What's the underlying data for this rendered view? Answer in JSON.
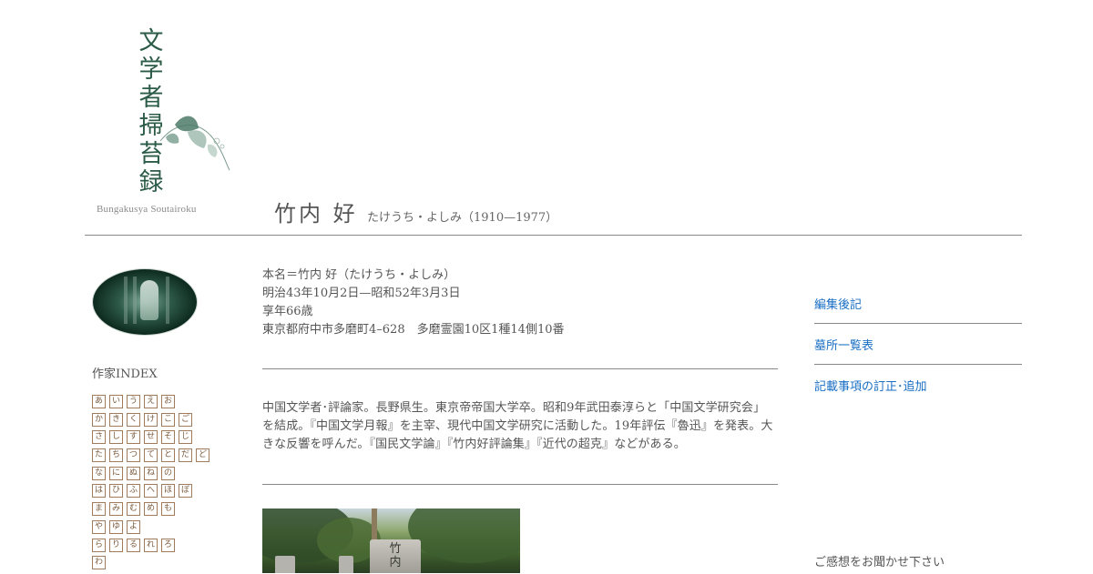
{
  "logo": {
    "title_chars": [
      "文",
      "学",
      "者",
      "掃",
      "苔",
      "録"
    ],
    "roman": "Bungakusya Soutairoku"
  },
  "header": {
    "name": "竹内 好",
    "reading": "たけうち・よしみ（1910—1977）"
  },
  "sidebar": {
    "index_heading": "作家INDEX",
    "kana_rows": [
      [
        "あ",
        "い",
        "う",
        "え",
        "お"
      ],
      [
        "か",
        "き",
        "く",
        "け",
        "こ",
        "ご"
      ],
      [
        "さ",
        "し",
        "す",
        "せ",
        "そ",
        "じ"
      ],
      [
        "た",
        "ち",
        "つ",
        "て",
        "と",
        "だ",
        "ど"
      ],
      [
        "な",
        "に",
        "ぬ",
        "ね",
        "の"
      ],
      [
        "は",
        "ひ",
        "ふ",
        "へ",
        "ほ",
        "ぼ"
      ],
      [
        "ま",
        "み",
        "む",
        "め",
        "も"
      ],
      [
        "や",
        "ゆ",
        "よ"
      ],
      [
        "ら",
        "り",
        "る",
        "れ",
        "ろ"
      ],
      [
        "わ"
      ]
    ]
  },
  "main": {
    "info_lines": [
      "本名＝竹内 好（たけうち・よしみ）",
      "明治43年10月2日—昭和52年3月3日",
      "享年66歳",
      "東京都府中市多磨町4–628　多磨霊園10区1種14側10番"
    ],
    "bio": "中国文学者･評論家。長野県生。東京帝帝国大学卒。昭和9年武田泰淳らと「中国文学研究会」を結成。『中国文学月報』を主宰、現代中国文学研究に活動した。19年評伝『魯迅』を発表。大きな反響を呼んだ。『国民文学論』『竹内好評論集』『近代の超克』などがある。",
    "photo_text": "竹内"
  },
  "right_nav": {
    "links": [
      "編集後記",
      "墓所一覧表",
      "記載事項の訂正･追加"
    ],
    "feedback": "ご感想をお聞かせ下さい"
  },
  "colors": {
    "link": "#1a6fc4",
    "kana_border": "#a07c5c",
    "logo_green": "#2c5b47",
    "rule": "#888888"
  }
}
